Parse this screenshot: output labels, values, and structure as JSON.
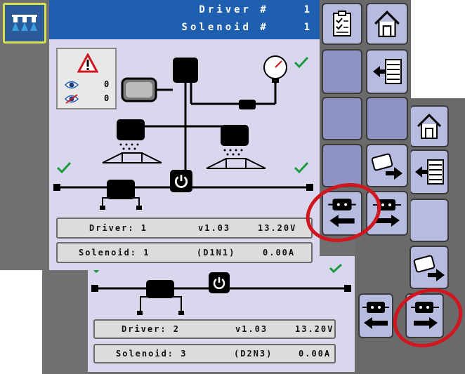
{
  "header": {
    "driver_label": "Driver #",
    "driver_num": "1",
    "solenoid_label": "Solenoid #",
    "solenoid_num": "1"
  },
  "alarm": {
    "seen_count": "0",
    "hidden_count": "0"
  },
  "front": {
    "driver_bar": {
      "label": "Driver: 1",
      "version": "v1.03",
      "voltage": "13.20V"
    },
    "solenoid_bar": {
      "label": "Solenoid: 1",
      "code": "(D1N1)",
      "current": "0.00A"
    }
  },
  "back": {
    "driver_bar": {
      "label": "Driver: 2",
      "version": "v1.03",
      "voltage": "13.20V"
    },
    "solenoid_bar": {
      "label": "Solenoid: 3",
      "code": "(D2N3)",
      "current": "0.00A"
    }
  },
  "colors": {
    "header_blue": "#1f5fb0",
    "panel_bg": "#d8d7ee",
    "tile_bg": "#b8bbe0",
    "check_green": "#1a9a3a",
    "annotation_red": "#d0161e",
    "side_bar": "#707070"
  },
  "icons": [
    "boom-sections-icon",
    "checklist-icon",
    "home-icon",
    "back-arrow-icon",
    "previous-driver-icon",
    "next-driver-icon",
    "warning-icon",
    "eye-icon",
    "eye-hidden-icon",
    "pressure-gauge-icon",
    "power-icon",
    "check-icon"
  ]
}
